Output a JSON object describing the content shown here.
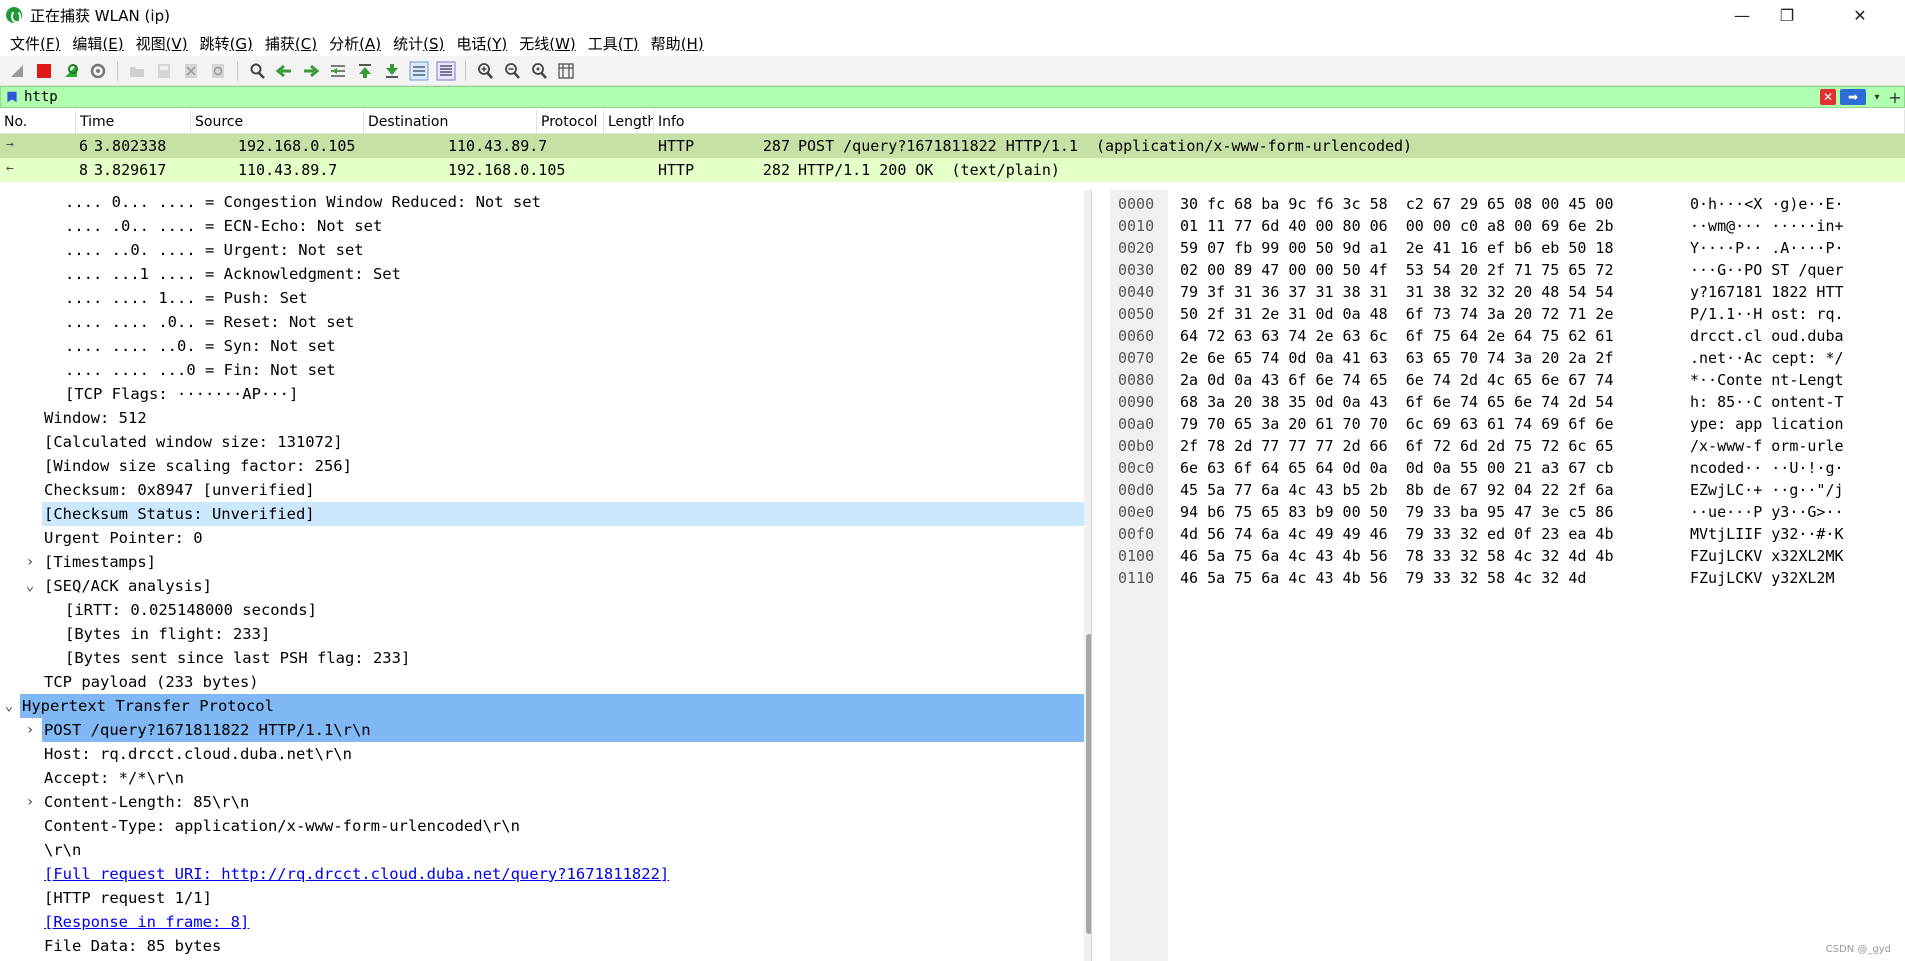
{
  "window": {
    "title": "正在捕获 WLAN (ip)",
    "min_glyph": "—",
    "max_glyph": "❐",
    "close_glyph": "✕"
  },
  "menu": [
    {
      "label": "文件",
      "key": "(F)"
    },
    {
      "label": "编辑",
      "key": "(E)"
    },
    {
      "label": "视图",
      "key": "(V)"
    },
    {
      "label": "跳转",
      "key": "(G)"
    },
    {
      "label": "捕获",
      "key": "(C)"
    },
    {
      "label": "分析",
      "key": "(A)"
    },
    {
      "label": "统计",
      "key": "(S)"
    },
    {
      "label": "电话",
      "key": "(Y)"
    },
    {
      "label": "无线",
      "key": "(W)"
    },
    {
      "label": "工具",
      "key": "(T)"
    },
    {
      "label": "帮助",
      "key": "(H)"
    }
  ],
  "toolbar": {
    "icons": [
      "shark-fin-start-icon",
      "stop-icon",
      "restart-icon",
      "capture-options-icon",
      "open-file-icon",
      "save-file-icon",
      "close-file-icon",
      "reload-icon",
      "find-icon",
      "go-back-icon",
      "go-forward-icon",
      "go-to-packet-icon",
      "go-first-icon",
      "go-last-icon",
      "autoscroll-icon",
      "colorize-icon",
      "zoom-in-icon",
      "zoom-out-icon",
      "zoom-reset-icon",
      "resize-columns-icon"
    ]
  },
  "filter": {
    "value": "http",
    "clear_glyph": "✕",
    "apply_glyph": "➡",
    "dropdown_glyph": "▾",
    "add_glyph": "+"
  },
  "packet_list": {
    "columns": [
      "No.",
      "Time",
      "Source",
      "Destination",
      "Protocol",
      "Length",
      "Info"
    ],
    "rows": [
      {
        "arrow": "→",
        "no": "6",
        "time": "3.802338",
        "src": "192.168.0.105",
        "dst": "110.43.89.7",
        "proto": "HTTP",
        "len": "287",
        "info": "POST /query?1671811822 HTTP/1.1  (application/x-www-form-urlencoded)",
        "bg": "#c6e0a6"
      },
      {
        "arrow": "←",
        "no": "8",
        "time": "3.829617",
        "src": "110.43.89.7",
        "dst": "192.168.0.105",
        "proto": "HTTP",
        "len": "282",
        "info": "HTTP/1.1 200 OK  (text/plain)",
        "bg": "#e4ffc7"
      }
    ]
  },
  "details": [
    {
      "indent": 3,
      "exp": "",
      "text": ".... 0... .... = Congestion Window Reduced: Not set"
    },
    {
      "indent": 3,
      "exp": "",
      "text": ".... .0.. .... = ECN-Echo: Not set"
    },
    {
      "indent": 3,
      "exp": "",
      "text": ".... ..0. .... = Urgent: Not set"
    },
    {
      "indent": 3,
      "exp": "",
      "text": ".... ...1 .... = Acknowledgment: Set"
    },
    {
      "indent": 3,
      "exp": "",
      "text": ".... .... 1... = Push: Set"
    },
    {
      "indent": 3,
      "exp": "",
      "text": ".... .... .0.. = Reset: Not set"
    },
    {
      "indent": 3,
      "exp": "",
      "text": ".... .... ..0. = Syn: Not set"
    },
    {
      "indent": 3,
      "exp": "",
      "text": ".... .... ...0 = Fin: Not set"
    },
    {
      "indent": 3,
      "exp": "",
      "text": "[TCP Flags: ·······AP···]"
    },
    {
      "indent": 2,
      "exp": "",
      "text": "Window: 512"
    },
    {
      "indent": 2,
      "exp": "",
      "text": "[Calculated window size: 131072]"
    },
    {
      "indent": 2,
      "exp": "",
      "text": "[Window size scaling factor: 256]"
    },
    {
      "indent": 2,
      "exp": "",
      "text": "Checksum: 0x8947 [unverified]"
    },
    {
      "indent": 2,
      "exp": "",
      "text": "[Checksum Status: Unverified]",
      "sel": "light"
    },
    {
      "indent": 2,
      "exp": "",
      "text": "Urgent Pointer: 0"
    },
    {
      "indent": 2,
      "exp": "›",
      "text": "[Timestamps]"
    },
    {
      "indent": 2,
      "exp": "⌄",
      "text": "[SEQ/ACK analysis]"
    },
    {
      "indent": 3,
      "exp": "",
      "text": "[iRTT: 0.025148000 seconds]"
    },
    {
      "indent": 3,
      "exp": "",
      "text": "[Bytes in flight: 233]"
    },
    {
      "indent": 3,
      "exp": "",
      "text": "[Bytes sent since last PSH flag: 233]"
    },
    {
      "indent": 2,
      "exp": "",
      "text": "TCP payload (233 bytes)"
    },
    {
      "indent": 1,
      "exp": "⌄",
      "text": "Hypertext Transfer Protocol",
      "sel": "dark"
    },
    {
      "indent": 2,
      "exp": "›",
      "text": "POST /query?1671811822 HTTP/1.1\\r\\n",
      "sel": "dark"
    },
    {
      "indent": 2,
      "exp": "",
      "text": "Host: rq.drcct.cloud.duba.net\\r\\n"
    },
    {
      "indent": 2,
      "exp": "",
      "text": "Accept: */*\\r\\n"
    },
    {
      "indent": 2,
      "exp": "›",
      "text": "Content-Length: 85\\r\\n"
    },
    {
      "indent": 2,
      "exp": "",
      "text": "Content-Type: application/x-www-form-urlencoded\\r\\n"
    },
    {
      "indent": 2,
      "exp": "",
      "text": "\\r\\n"
    },
    {
      "indent": 2,
      "exp": "",
      "text": "[Full request URI: http://rq.drcct.cloud.duba.net/query?1671811822]",
      "link": true
    },
    {
      "indent": 2,
      "exp": "",
      "text": "[HTTP request 1/1]"
    },
    {
      "indent": 2,
      "exp": "",
      "text": "[Response in frame: 8]",
      "link": true
    },
    {
      "indent": 2,
      "exp": "",
      "text": "File Data: 85 bytes"
    }
  ],
  "bytes": [
    {
      "off": "0000",
      "hex": "30 fc 68 ba 9c f6 3c 58  c2 67 29 65 08 00 45 00",
      "ascii": "0·h···<X ·g)e··E·"
    },
    {
      "off": "0010",
      "hex": "01 11 77 6d 40 00 80 06  00 00 c0 a8 00 69 6e 2b",
      "ascii": "··wm@··· ·····in+"
    },
    {
      "off": "0020",
      "hex": "59 07 fb 99 00 50 9d a1  2e 41 16 ef b6 eb 50 18",
      "ascii": "Y····P·· .A····P·"
    },
    {
      "off": "0030",
      "hex": "02 00 89 47 00 00 50 4f  53 54 20 2f 71 75 65 72",
      "ascii": "···G··PO ST /quer"
    },
    {
      "off": "0040",
      "hex": "79 3f 31 36 37 31 38 31  31 38 32 32 20 48 54 54",
      "ascii": "y?167181 1822 HTT"
    },
    {
      "off": "0050",
      "hex": "50 2f 31 2e 31 0d 0a 48  6f 73 74 3a 20 72 71 2e",
      "ascii": "P/1.1··H ost: rq."
    },
    {
      "off": "0060",
      "hex": "64 72 63 63 74 2e 63 6c  6f 75 64 2e 64 75 62 61",
      "ascii": "drcct.cl oud.duba"
    },
    {
      "off": "0070",
      "hex": "2e 6e 65 74 0d 0a 41 63  63 65 70 74 3a 20 2a 2f",
      "ascii": ".net··Ac cept: */"
    },
    {
      "off": "0080",
      "hex": "2a 0d 0a 43 6f 6e 74 65  6e 74 2d 4c 65 6e 67 74",
      "ascii": "*··Conte nt-Lengt"
    },
    {
      "off": "0090",
      "hex": "68 3a 20 38 35 0d 0a 43  6f 6e 74 65 6e 74 2d 54",
      "ascii": "h: 85··C ontent-T"
    },
    {
      "off": "00a0",
      "hex": "79 70 65 3a 20 61 70 70  6c 69 63 61 74 69 6f 6e",
      "ascii": "ype: app lication"
    },
    {
      "off": "00b0",
      "hex": "2f 78 2d 77 77 77 2d 66  6f 72 6d 2d 75 72 6c 65",
      "ascii": "/x-www-f orm-urle"
    },
    {
      "off": "00c0",
      "hex": "6e 63 6f 64 65 64 0d 0a  0d 0a 55 00 21 a3 67 cb",
      "ascii": "ncoded·· ··U·!·g·"
    },
    {
      "off": "00d0",
      "hex": "45 5a 77 6a 4c 43 b5 2b  8b de 67 92 04 22 2f 6a",
      "ascii": "EZwjLC·+ ··g··\"/j"
    },
    {
      "off": "00e0",
      "hex": "94 b6 75 65 83 b9 00 50  79 33 ba 95 47 3e c5 86",
      "ascii": "··ue···P y3··G>··"
    },
    {
      "off": "00f0",
      "hex": "4d 56 74 6a 4c 49 49 46  79 33 32 ed 0f 23 ea 4b",
      "ascii": "MVtjLIIF y32··#·K"
    },
    {
      "off": "0100",
      "hex": "46 5a 75 6a 4c 43 4b 56  78 33 32 58 4c 32 4d 4b",
      "ascii": "FZujLCKV x32XL2MK"
    },
    {
      "off": "0110",
      "hex": "46 5a 75 6a 4c 43 4b 56  79 33 32 58 4c 32 4d",
      "ascii": "FZujLCKV y32XL2M"
    }
  ],
  "watermark": "CSDN @_gyd"
}
